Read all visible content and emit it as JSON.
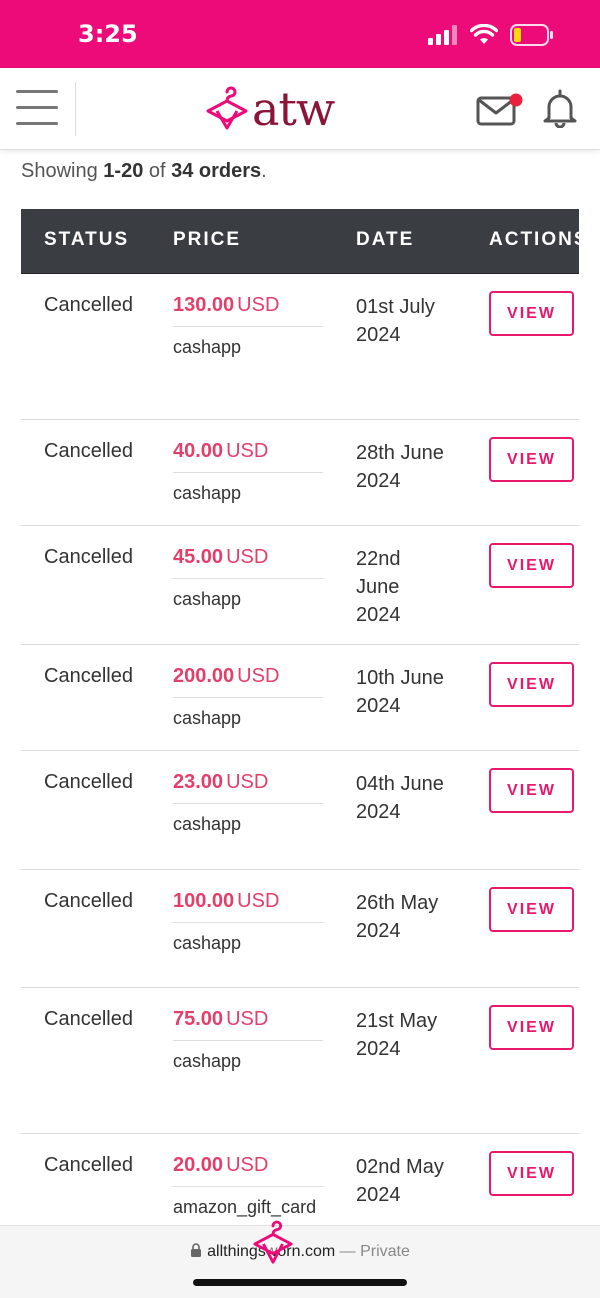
{
  "status_bar": {
    "time": "3:25"
  },
  "header": {
    "logo_text": "atw"
  },
  "summary": {
    "prefix": "Showing ",
    "range": "1-20",
    "mid": " of ",
    "total": "34 orders",
    "suffix": "."
  },
  "table": {
    "headers": {
      "status": "STATUS",
      "price": "PRICE",
      "date": "DATE",
      "action": "ACTIONS"
    },
    "rows": [
      {
        "status": "Cancelled",
        "price": "130.00",
        "currency": "USD",
        "method": "cashapp",
        "date": "01st July 2024",
        "action": "VIEW"
      },
      {
        "status": "Cancelled",
        "price": "40.00",
        "currency": "USD",
        "method": "cashapp",
        "date": "28th June 2024",
        "action": "VIEW"
      },
      {
        "status": "Cancelled",
        "price": "45.00",
        "currency": "USD",
        "method": "cashapp",
        "date": "22nd June 2024",
        "action": "VIEW"
      },
      {
        "status": "Cancelled",
        "price": "200.00",
        "currency": "USD",
        "method": "cashapp",
        "date": "10th June 2024",
        "action": "VIEW"
      },
      {
        "status": "Cancelled",
        "price": "23.00",
        "currency": "USD",
        "method": "cashapp",
        "date": "04th June 2024",
        "action": "VIEW"
      },
      {
        "status": "Cancelled",
        "price": "100.00",
        "currency": "USD",
        "method": "cashapp",
        "date": "26th May 2024",
        "action": "VIEW"
      },
      {
        "status": "Cancelled",
        "price": "75.00",
        "currency": "USD",
        "method": "cashapp",
        "date": "21st May 2024",
        "action": "VIEW"
      },
      {
        "status": "Cancelled",
        "price": "20.00",
        "currency": "USD",
        "method": "amazon_gift_card",
        "date": "02nd May 2024",
        "action": "VIEW"
      }
    ]
  },
  "browser_bar": {
    "url": "allthingsworn.com",
    "separator": " — ",
    "mode": "Private"
  },
  "colors": {
    "brand_pink": "#ec0b78",
    "price_red": "#e23f6b",
    "logo_maroon": "#8a1538",
    "table_header": "#3a3d42"
  },
  "icons": {
    "menu": "hamburger-icon",
    "mail": "mail-icon",
    "notifications": "bell-icon",
    "lock": "lock-icon"
  }
}
